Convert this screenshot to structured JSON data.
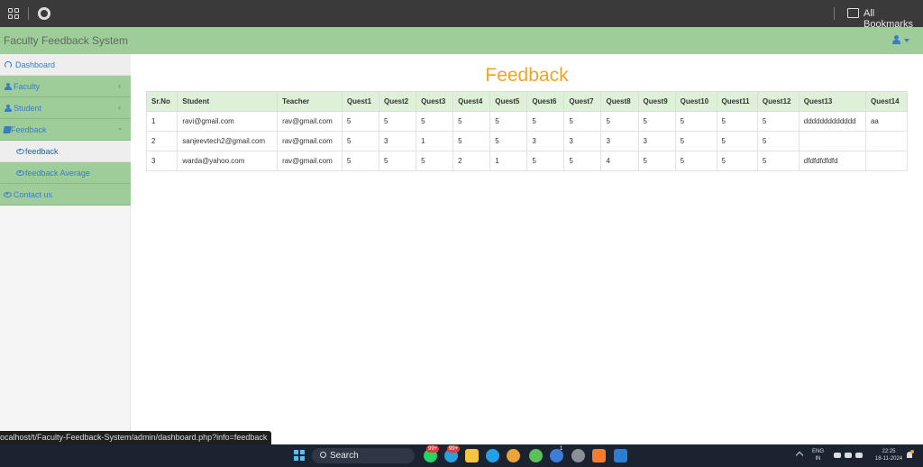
{
  "browser": {
    "bookmarks_label": "All Bookmarks",
    "status_url": "ocalhost/t/Faculty-Feedback-System/admin/dashboard.php?info=feedback"
  },
  "app": {
    "title": "Faculty Feedback System"
  },
  "sidebar": {
    "items": [
      {
        "label": "Dashboard",
        "icon": "dashboard-icon"
      },
      {
        "label": "Faculty",
        "icon": "user-icon"
      },
      {
        "label": "Student",
        "icon": "user-icon"
      },
      {
        "label": "Feedback",
        "icon": "book-icon"
      },
      {
        "label": "feedback",
        "icon": "eye-icon"
      },
      {
        "label": "feedback Average",
        "icon": "eye-icon"
      },
      {
        "label": "Contact us",
        "icon": "eye-icon"
      }
    ]
  },
  "main": {
    "title": "Feedback",
    "table": {
      "headers": [
        "Sr.No",
        "Student",
        "Teacher",
        "Quest1",
        "Quest2",
        "Quest3",
        "Quest4",
        "Quest5",
        "Quest6",
        "Quest7",
        "Quest8",
        "Quest9",
        "Quest10",
        "Quest11",
        "Quest12",
        "Quest13",
        "Quest14"
      ],
      "rows": [
        [
          "1",
          "ravi@gmail.com",
          "rav@gmail.com",
          "5",
          "5",
          "5",
          "5",
          "5",
          "5",
          "5",
          "5",
          "5",
          "5",
          "5",
          "5",
          "ddddddddddddd",
          "aa"
        ],
        [
          "2",
          "sanjeevtech2@gmail.com",
          "rav@gmail.com",
          "5",
          "3",
          "1",
          "5",
          "5",
          "3",
          "3",
          "3",
          "3",
          "5",
          "5",
          "5",
          "",
          ""
        ],
        [
          "3",
          "warda@yahoo.com",
          "rav@gmail.com",
          "5",
          "5",
          "5",
          "2",
          "1",
          "5",
          "5",
          "4",
          "5",
          "5",
          "5",
          "5",
          "dfdfdfdfdfd",
          ""
        ]
      ]
    }
  },
  "taskbar": {
    "search_label": "Search",
    "badge_1": "99+",
    "badge_2": "99+",
    "badge_3": "1",
    "lang_line1": "ENG",
    "lang_line2": "IN",
    "time": "22:25",
    "date": "18-11-2024"
  },
  "colors": {
    "header_green": "#9fcd9a",
    "title_orange": "#f4a31f",
    "link_blue": "#3b7dc4",
    "table_header_bg": "#dff0d8"
  }
}
